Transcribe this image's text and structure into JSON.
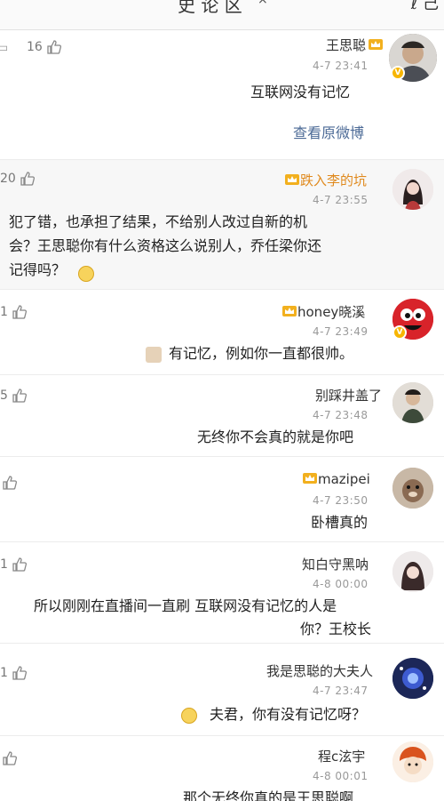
{
  "header": {
    "title": "史 论 区",
    "mark": "×",
    "right": "ℓ 己"
  },
  "comments": [
    {
      "name": "王思聪",
      "time": "4-7 23:41",
      "text": "互联网没有记忆",
      "likes": "16",
      "link": "查看原微博",
      "vip": true,
      "verified": true
    },
    {
      "name": "跌入李的坑",
      "time": "4-7 23:55",
      "lines": [
        "犯了错，也承担了结果，不给别人改过自新的机",
        "会？王思聪你有什么资格这么说别人，乔任梁你还",
        "记得吗？"
      ],
      "likes": "20",
      "vip": true
    },
    {
      "name": "honey晓溪",
      "time": "4-7 23:49",
      "text": "有记忆，例如你一直都很帅。",
      "likes": "1",
      "vip": true,
      "verified": true
    },
    {
      "name": "别踩井盖了",
      "time": "4-7 23:48",
      "text": "无终你不会真的就是你吧",
      "likes": "5"
    },
    {
      "name": "mazipei",
      "time": "4-7 23:50",
      "text": "卧槽真的",
      "vip": true
    },
    {
      "name": "知白守黑呐",
      "time": "4-8 00:00",
      "lines": [
        "所以刚刚在直播间一直刷 互联网没有记忆的人是",
        "你？王校长"
      ],
      "likes": "1"
    },
    {
      "name": "我是思聪的大夫人",
      "time": "4-7 23:47",
      "text": "夫君，你有没有记忆呀？",
      "likes": "1"
    },
    {
      "name": "程c泫宇",
      "time": "4-8 00:01",
      "text": "那个无终你真的是王思聪啊"
    }
  ],
  "colors": {
    "link": "#4d6b97",
    "time": "#999999",
    "crown": "#f2b01e",
    "badge": "#f7b500"
  }
}
